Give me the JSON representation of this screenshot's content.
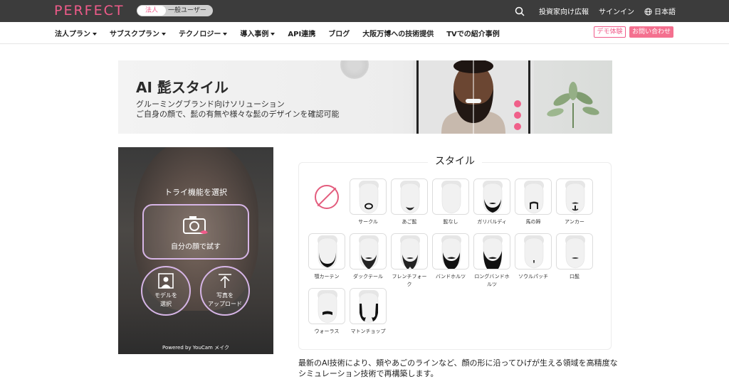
{
  "topbar": {
    "logo": "PERFECT",
    "toggle_active": "法人",
    "toggle_inactive": "一般ユーザー",
    "investor": "投資家向け広報",
    "signin": "サインイン",
    "language": "日本語"
  },
  "nav": {
    "items": [
      {
        "label": "法人プラン",
        "caret": true
      },
      {
        "label": "サブスクプラン",
        "caret": true
      },
      {
        "label": "テクノロジー",
        "caret": true
      },
      {
        "label": "導入事例",
        "caret": true
      },
      {
        "label": "API連携",
        "caret": false
      },
      {
        "label": "ブログ",
        "caret": false
      },
      {
        "label": "大阪万博への技術提供",
        "caret": false
      },
      {
        "label": "TVでの紹介事例",
        "caret": false
      }
    ],
    "demo": "デモ体験",
    "contact": "お問い合わせ"
  },
  "banner": {
    "title": "AI 髭スタイル",
    "subtitle1": "グルーミングブランド向けソリューション",
    "subtitle2": "ご自身の顔で、髭の有無や様々な髭のデザインを確認可能"
  },
  "try_panel": {
    "label": "トライ機能を選択",
    "camera_button": "自分の顔で試す",
    "model_button": [
      "モデルを",
      "選択"
    ],
    "upload_button": [
      "写真を",
      "アップロード"
    ],
    "powered": "Powered by YouCam メイク"
  },
  "styles": {
    "title": "スタイル",
    "items": [
      {
        "label": "",
        "kind": "none"
      },
      {
        "label": "サークル",
        "kind": "circle"
      },
      {
        "label": "あご髭",
        "kind": "chin"
      },
      {
        "label": "髭なし",
        "kind": "clean"
      },
      {
        "label": "ガリバルディ",
        "kind": "full"
      },
      {
        "label": "馬の蹄",
        "kind": "horseshoe"
      },
      {
        "label": "アンカー",
        "kind": "anchor"
      },
      {
        "label": "顎カーテン",
        "kind": "curtain"
      },
      {
        "label": "ダックテール",
        "kind": "duck"
      },
      {
        "label": "フレンチフォーク",
        "kind": "fork"
      },
      {
        "label": "バンドホルツ",
        "kind": "bandholz"
      },
      {
        "label": "ロングバンドホルツ",
        "kind": "longbandholz"
      },
      {
        "label": "ソウルパッチ",
        "kind": "soul"
      },
      {
        "label": "口髭",
        "kind": "mustache"
      },
      {
        "label": "ウォーラス",
        "kind": "walrus"
      },
      {
        "label": "マトンチョップ",
        "kind": "mutton"
      }
    ]
  },
  "description": "最新のAI技術により、頬やあごのラインなど、顔の形に沿ってひげが生える領域を高精度なシミュレーション技術で再構築します。",
  "colors": {
    "brand": "#f05b8a",
    "topbar": "#3c3c3c"
  }
}
